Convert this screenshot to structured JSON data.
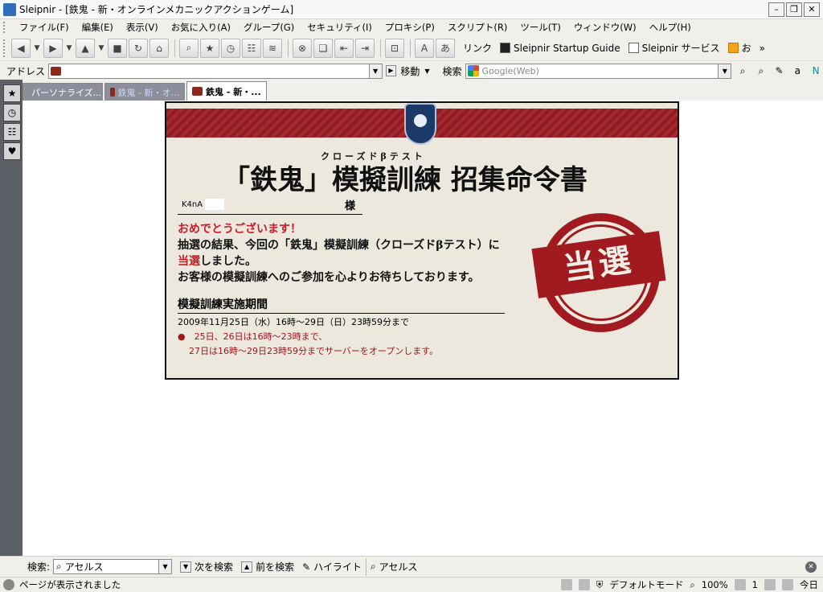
{
  "window": {
    "title": "Sleipnir - [鉄鬼 - 新・オンラインメカニックアクションゲーム]",
    "min": "–",
    "max": "❐",
    "close": "✕"
  },
  "menu": [
    "ファイル(F)",
    "編集(E)",
    "表示(V)",
    "お気に入り(A)",
    "グループ(G)",
    "セキュリティ(I)",
    "プロキシ(P)",
    "スクリプト(R)",
    "ツール(T)",
    "ウィンドウ(W)",
    "ヘルプ(H)"
  ],
  "toolbar": {
    "links_label": "リンク",
    "link1": "Sleipnir Startup Guide",
    "link2": "Sleipnir サービス",
    "link3": "お",
    "more": "»"
  },
  "address": {
    "label": "アドレス",
    "value": "",
    "go_label": "移動",
    "search_label": "検索",
    "search_placeholder": "Google(Web)"
  },
  "tabs": [
    {
      "label": "パーソナライズ..."
    },
    {
      "label": "鉄鬼 - 新・オ..."
    },
    {
      "label": "鉄鬼 - 新・..."
    }
  ],
  "page": {
    "ruby": "クローズドβテスト",
    "headline": "「鉄鬼」模擬訓練 招集命令書",
    "name": "K4nA",
    "honorific": "様",
    "congrats": "おめでとうございます！",
    "line2": "抽選の結果、今回の「鉄鬼」模擬訓練（クローズドβテスト）に",
    "line3_red": "当選",
    "line3_rest": "しました。",
    "line4": "お客様の模擬訓練へのご参加を心よりお待ちしております。",
    "period_title": "模擬訓練実施期間",
    "period_date": "2009年11月25日（水）16時～29日（日）23時59分まで",
    "note1": "●　25日、26日は16時～23時まで、",
    "note2": "27日は16時～29日23時59分までサーバーをオープンします。",
    "stamp": "当選"
  },
  "findbar": {
    "label": "検索:",
    "value": "アセルス",
    "next": "次を検索",
    "prev": "前を検索",
    "highlight": "ハイライト",
    "word": "アセルス"
  },
  "status": {
    "text": "ページが表示されました",
    "mode": "デフォルトモード",
    "zoom": "100%",
    "count": "1",
    "today": "今日"
  }
}
